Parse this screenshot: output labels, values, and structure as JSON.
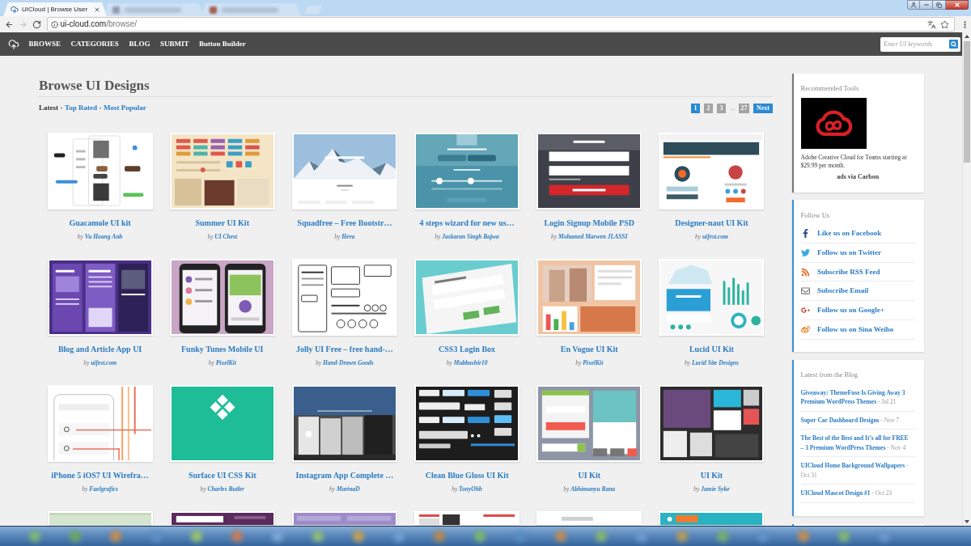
{
  "browser": {
    "tabs": [
      {
        "title": "UICloud | Browse User",
        "selected": true
      },
      {
        "selected": false
      },
      {
        "selected": false
      }
    ],
    "nav_buttons": [
      {
        "kind": "back",
        "disabled": false
      },
      {
        "kind": "forward",
        "disabled": true
      },
      {
        "kind": "reload",
        "disabled": false
      }
    ],
    "url": {
      "host": "ui-cloud.com",
      "path": "/browse/"
    }
  },
  "site_nav": {
    "links": [
      "BROWSE",
      "CATEGORIES",
      "BLOG",
      "SUBMIT",
      "Button Builder"
    ],
    "search": {
      "placeholder": "Enter UI keywords"
    }
  },
  "main": {
    "title": "Browse UI Designs",
    "sort": [
      {
        "kind": "option",
        "label": "Latest",
        "selected": true
      },
      {
        "kind": "separator",
        "label": "·"
      },
      {
        "kind": "option",
        "label": "Top Rated",
        "selected": false
      },
      {
        "kind": "separator",
        "label": "·"
      },
      {
        "kind": "option",
        "label": "Most Popular",
        "selected": false
      }
    ],
    "pagination": [
      {
        "kind": "page",
        "label": "1",
        "selected": true
      },
      {
        "kind": "page",
        "label": "2",
        "selected": false
      },
      {
        "kind": "page",
        "label": "3",
        "selected": false
      },
      {
        "kind": "gap",
        "label": "..."
      },
      {
        "kind": "page",
        "label": "27",
        "selected": false
      },
      {
        "kind": "next",
        "label": "Next"
      }
    ]
  },
  "cards": [
    {
      "kind": "full",
      "title": "Guacamole UI kit",
      "by": "by",
      "author": "Vu Hoang Anh"
    },
    {
      "kind": "full",
      "title": "Summer UI Kit",
      "by": "by",
      "author": "UI Chest"
    },
    {
      "kind": "full",
      "title": "Squadfree – Free Bootstr…",
      "by": "by",
      "author": "Heru"
    },
    {
      "kind": "full",
      "title": "4 steps wizard for new us…",
      "by": "by",
      "author": "Jaskaran Singh Bajwa"
    },
    {
      "kind": "full",
      "title": "Login Signup Mobile PSD",
      "by": "by",
      "author": "Mohamed Marwen JLASSI"
    },
    {
      "kind": "full",
      "title": "Designer-naut UI Kit",
      "by": "by",
      "author": "uifest.com"
    },
    {
      "kind": "full",
      "title": "Blog and Article App UI",
      "by": "by",
      "author": "uifest.com"
    },
    {
      "kind": "full",
      "title": "Funky Tunes Mobile UI",
      "by": "by",
      "author": "PixelKit"
    },
    {
      "kind": "full",
      "title": "Jolly UI Free – free hand-…",
      "by": "by",
      "author": "Hand-Drawn Goods"
    },
    {
      "kind": "full",
      "title": "CSS3 Login Box",
      "by": "by",
      "author": "Mubbashir10"
    },
    {
      "kind": "full",
      "title": "En Vogue UI Kit",
      "by": "by",
      "author": "PixelKit"
    },
    {
      "kind": "full",
      "title": "Lucid UI Kit",
      "by": "by",
      "author": "Lucid Site Designs"
    },
    {
      "kind": "full",
      "title": "iPhone 5 iOS7 UI Wirefra…",
      "by": "by",
      "author": "Fuelgrafics"
    },
    {
      "kind": "full",
      "title": "Surface UI CSS Kit",
      "by": "by",
      "author": "Charles Butler"
    },
    {
      "kind": "full",
      "title": "Instagram App Complete …",
      "by": "by",
      "author": "MarinaD"
    },
    {
      "kind": "full",
      "title": "Clean Blue Gloss UI Kit",
      "by": "by",
      "author": "TonyOhh"
    },
    {
      "kind": "full",
      "title": "UI Kit",
      "by": "by",
      "author": "Abhimanyu Rana"
    },
    {
      "kind": "full",
      "title": "UI Kit",
      "by": "by",
      "author": "Jamie Syke"
    },
    {
      "kind": "partial"
    },
    {
      "kind": "partial"
    },
    {
      "kind": "partial"
    },
    {
      "kind": "partial"
    },
    {
      "kind": "partial"
    },
    {
      "kind": "partial"
    }
  ],
  "sidebar": {
    "ad": {
      "heading": "Recommended Tools",
      "text": "Adobe Creative Cloud for Teams starting at $29.99 per month.",
      "credit": "ads via Carbon"
    },
    "follow": {
      "heading": "Follow Us",
      "links": [
        {
          "kind": "facebook",
          "label": "Like us on Facebook"
        },
        {
          "kind": "twitter",
          "label": "Follow us on Twitter"
        },
        {
          "kind": "rss",
          "label": "Subscribe RSS Feed"
        },
        {
          "kind": "email",
          "label": "Subscribe Email"
        },
        {
          "kind": "googleplus",
          "label": "Follow us on Google+"
        },
        {
          "kind": "weibo",
          "label": "Follow us on Sina Weibo"
        }
      ]
    },
    "blog": {
      "heading": "Latest from the Blog",
      "posts": [
        {
          "title": "Giveaway: ThemeFuse Is Giving Away 3 Premium WordPress Themes",
          "date": "- Jul 21"
        },
        {
          "title": "Super Car Dashboard Designs",
          "date": "- Nov 7"
        },
        {
          "title": "The Best of the Best and It’s all for FREE – 3 Premium WordPress Themes",
          "date": "- Nov 4"
        },
        {
          "title": "UICloud Home Background Wallpapers",
          "date": "- Oct 31"
        },
        {
          "title": "UICloud Mascot Design #1",
          "date": "- Oct 23"
        }
      ]
    }
  }
}
